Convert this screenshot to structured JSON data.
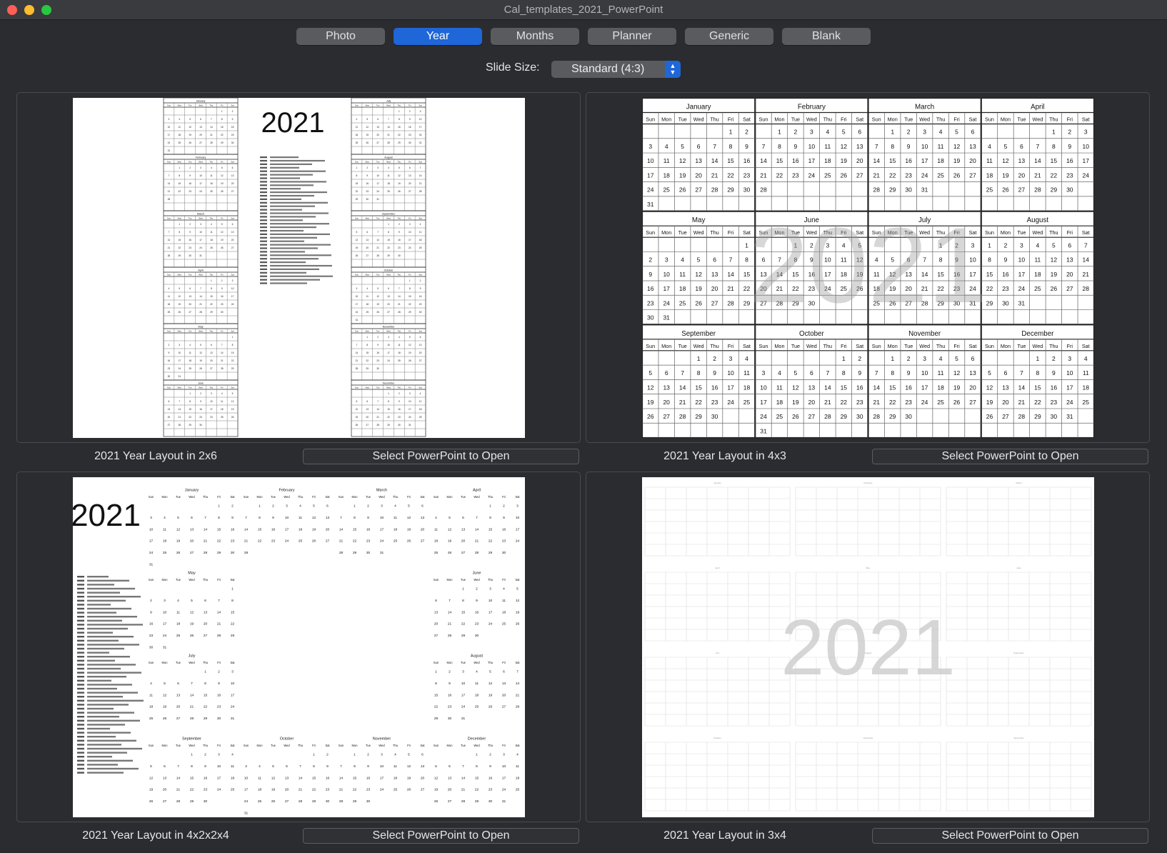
{
  "window": {
    "title": "Cal_templates_2021_PowerPoint"
  },
  "tabs": [
    {
      "label": "Photo",
      "active": false
    },
    {
      "label": "Year",
      "active": true
    },
    {
      "label": "Months",
      "active": false
    },
    {
      "label": "Planner",
      "active": false
    },
    {
      "label": "Generic",
      "active": false
    },
    {
      "label": "Blank",
      "active": false
    }
  ],
  "slide_size": {
    "label": "Slide Size:",
    "value": "Standard (4:3)"
  },
  "colors": {
    "accent": "#1f66d8",
    "background": "#2b2c2f",
    "button": "#5a5b5e"
  },
  "templates": [
    {
      "caption": "2021 Year Layout in 2x6",
      "button": "Select PowerPoint to Open"
    },
    {
      "caption": "2021 Year Layout in 4x3",
      "button": "Select PowerPoint to Open"
    },
    {
      "caption": "2021 Year Layout in 4x2x2x4",
      "button": "Select PowerPoint to Open"
    },
    {
      "caption": "2021 Year Layout in 3x4",
      "button": "Select PowerPoint to Open"
    }
  ],
  "calendar": {
    "year": "2021",
    "months": [
      "January",
      "February",
      "March",
      "April",
      "May",
      "June",
      "July",
      "August",
      "September",
      "October",
      "November",
      "December"
    ],
    "weekdays": [
      "Sun",
      "Mon",
      "Tue",
      "Wed",
      "Thu",
      "Fri",
      "Sat"
    ]
  }
}
